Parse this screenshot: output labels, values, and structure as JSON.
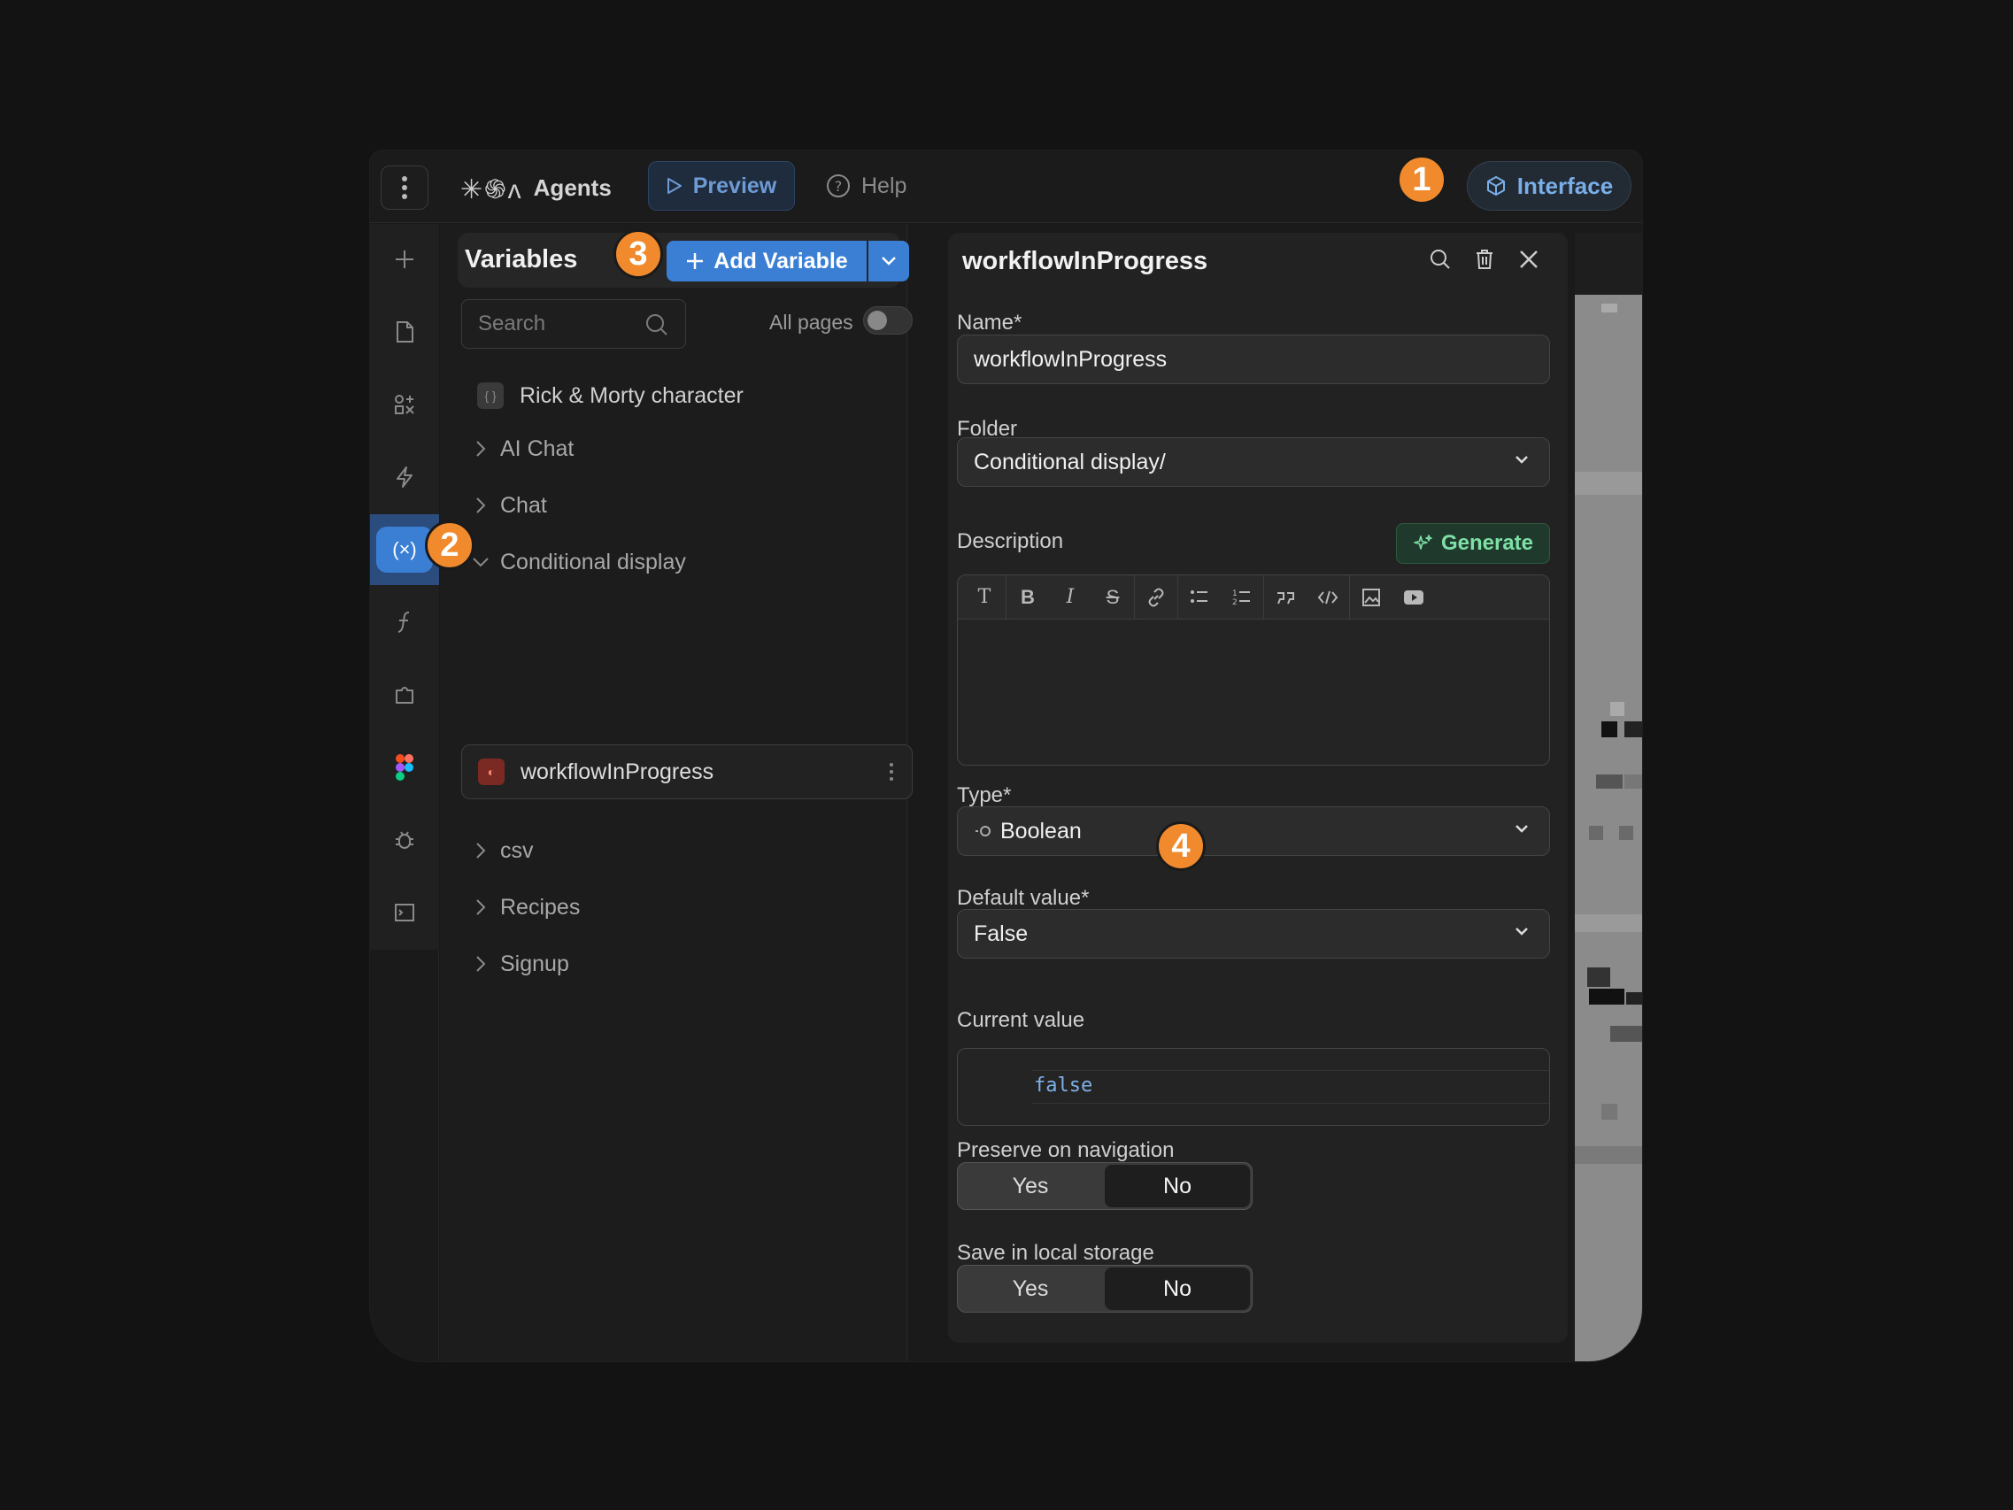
{
  "topbar": {
    "brand_glyphs": "✳︎֍ᴧ",
    "brand_name": "Agents",
    "preview_label": "Preview",
    "help_label": "Help",
    "interface_label": "Interface"
  },
  "badges": [
    "1",
    "2",
    "3",
    "4"
  ],
  "variables": {
    "title": "Variables",
    "add_label": "Add Variable",
    "search_placeholder": "Search",
    "all_pages_label": "All pages",
    "all_pages_on": false,
    "tree": [
      {
        "label": "Rick & Morty character",
        "kind": "leaf"
      },
      {
        "label": "AI Chat",
        "kind": "folder",
        "expanded": false
      },
      {
        "label": "Chat",
        "kind": "folder",
        "expanded": false
      },
      {
        "label": "Conditional display",
        "kind": "folder",
        "expanded": true
      },
      {
        "label": "workflowInProgress",
        "kind": "leaf",
        "selected": true
      },
      {
        "label": "csv",
        "kind": "folder",
        "expanded": false
      },
      {
        "label": "Recipes",
        "kind": "folder",
        "expanded": false
      },
      {
        "label": "Signup",
        "kind": "folder",
        "expanded": false
      }
    ]
  },
  "detail": {
    "title": "workflowInProgress",
    "name_label": "Name",
    "name_value": "workflowInProgress",
    "folder_label": "Folder",
    "folder_value": "Conditional display/",
    "description_label": "Description",
    "generate_label": "Generate",
    "type_label": "Type",
    "type_value": "Boolean",
    "default_label": "Default value",
    "default_value": "False",
    "current_label": "Current value",
    "current_value": "false",
    "preserve_label": "Preserve on navigation",
    "preserve_options": [
      "Yes",
      "No"
    ],
    "preserve_selected": "No",
    "local_label": "Save in local storage",
    "local_options": [
      "Yes",
      "No"
    ],
    "local_selected": "No",
    "required_mark": "*"
  },
  "colors": {
    "accent": "#3a7fd4",
    "badge": "#f08a2c",
    "generate": "#7ee0a6"
  }
}
